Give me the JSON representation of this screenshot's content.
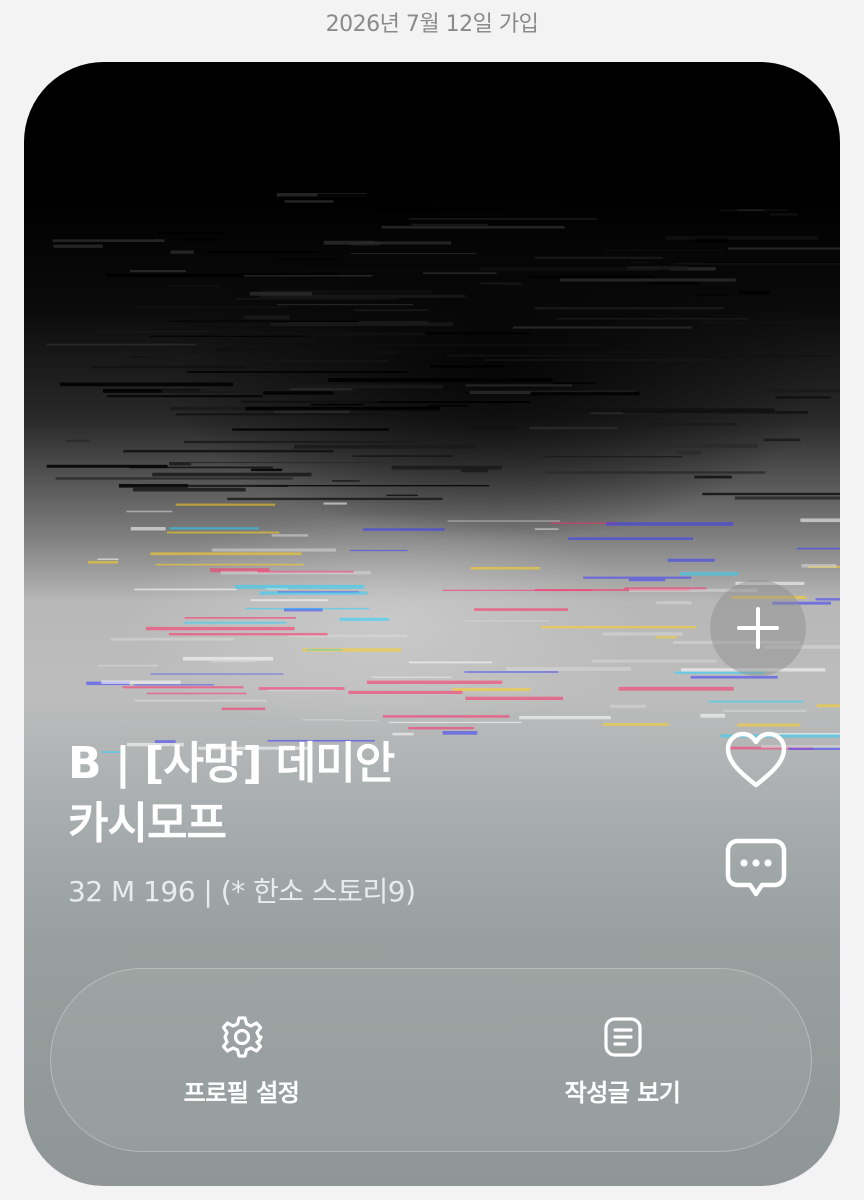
{
  "header": {
    "join_date": "2026년 7월 12일 가입"
  },
  "profile": {
    "name_line1": "B | [사망] 데미안",
    "name_line2": "카시모프",
    "meta": "32 M 196 | (* 한소 스토리9)"
  },
  "side_actions": [
    {
      "icon": "plus-icon"
    },
    {
      "icon": "heart-icon"
    },
    {
      "icon": "comment-bubble-icon"
    }
  ],
  "bottom_actions": {
    "settings": {
      "icon": "gear-icon",
      "label": "프로필 설정"
    },
    "posts": {
      "icon": "document-icon",
      "label": "작성글 보기"
    }
  },
  "colors": {
    "page_background": "#f3f3f3",
    "text_white": "#ffffff",
    "join_date": "#8a8a8a"
  }
}
